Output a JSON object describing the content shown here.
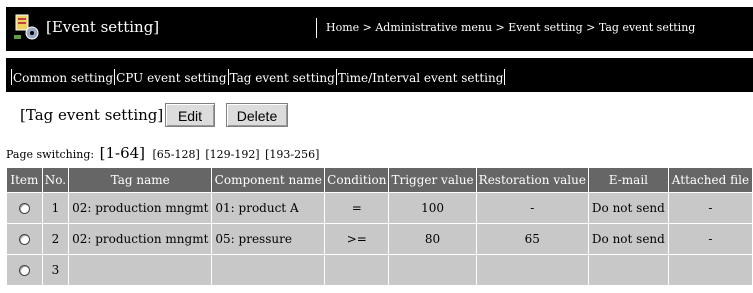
{
  "header": {
    "app_icon": "event-setting-icon",
    "title": "[Event setting]",
    "breadcrumb": "Home > Administrative menu > Event setting > Tag event setting"
  },
  "nav": {
    "items": [
      "Common setting",
      "CPU event setting",
      "Tag event setting",
      "Time/Interval event setting"
    ]
  },
  "section": {
    "title": "[Tag event setting]",
    "edit_label": "Edit",
    "delete_label": "Delete"
  },
  "paging": {
    "label": "Page switching:",
    "current": "[1-64]",
    "pages": [
      "[65-128]",
      "[129-192]",
      "[193-256]"
    ]
  },
  "table": {
    "columns": [
      "Item",
      "No.",
      "Tag name",
      "Component name",
      "Condition",
      "Trigger value",
      "Restoration value",
      "E-mail",
      "Attached file"
    ],
    "rows": [
      {
        "no": "1",
        "tag": "02: production mngmt",
        "component": "01: product A",
        "condition": "=",
        "trigger": "100",
        "restoration": "-",
        "email": "Do not send",
        "file": "-"
      },
      {
        "no": "2",
        "tag": "02: production mngmt",
        "component": "05: pressure",
        "condition": ">=",
        "trigger": "80",
        "restoration": "65",
        "email": "Do not send",
        "file": "-"
      },
      {
        "no": "3",
        "tag": "",
        "component": "",
        "condition": "",
        "trigger": "",
        "restoration": "",
        "email": "",
        "file": ""
      }
    ]
  },
  "colors": {
    "header_bg": "#000000",
    "table_header_bg": "#666666",
    "table_cell_bg": "#c8c8c8",
    "button_bg": "#dcdcdc"
  }
}
